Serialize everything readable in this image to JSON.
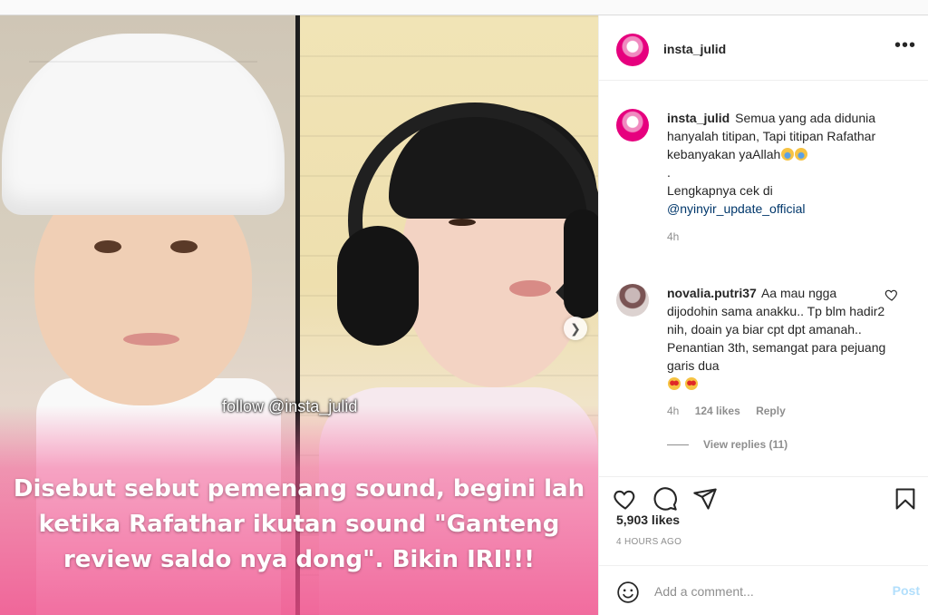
{
  "post": {
    "username": "insta_julid",
    "more_icon": "•••",
    "media": {
      "watermark": "follow @insta_julid",
      "overlay_caption": "Disebut sebut pemenang sound, begini lah ketika Rafathar ikutan sound \"Ganteng review saldo nya dong\". Bikin IRI!!!",
      "next_icon": "chevron-right-icon"
    },
    "caption": {
      "username": "insta_julid",
      "line1": "Semua yang ada didunia hanyalah titipan, Tapi titipan Rafathar kebanyakan yaAllah",
      "dot": ".",
      "line2": "Lengkapnya cek di",
      "mention": "@nyinyir_update_official",
      "time": "4h"
    },
    "comment": {
      "username": "novalia.putri37",
      "text": "Aa mau ngga dijodohin sama anakku.. Tp blm hadir2 nih, doain ya biar cpt dpt amanah.. Penantian 3th, semangat para pejuang garis dua",
      "time": "4h",
      "likes": "124 likes",
      "reply": "Reply",
      "view_replies": "View replies (11)"
    },
    "likes": "5,903 likes",
    "timestamp": "4 HOURS AGO",
    "add_comment_placeholder": "Add a comment...",
    "post_label": "Post",
    "colors": {
      "accent_post": "#b2dffc",
      "mention": "#00376b",
      "muted": "#8e8e8e",
      "overlay_pink": "#f04c8a"
    }
  }
}
